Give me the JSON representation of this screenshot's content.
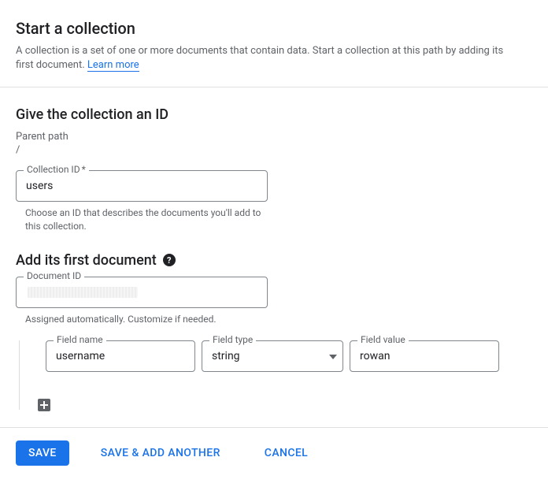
{
  "header": {
    "title": "Start a collection",
    "description": "A collection is a set of one or more documents that contain data. Start a collection at this path by adding its first document.",
    "learn_more": "Learn more"
  },
  "section_id": {
    "title": "Give the collection an ID",
    "parent_path_label": "Parent path",
    "parent_path_value": "/",
    "collection_id_label": "Collection ID",
    "required_mark": "*",
    "collection_id_value": "users",
    "collection_id_helper": "Choose an ID that describes the documents you'll add to this collection."
  },
  "section_doc": {
    "title": "Add its first document",
    "document_id_label": "Document ID",
    "document_id_value": "",
    "document_id_helper": "Assigned automatically. Customize if needed."
  },
  "fields": {
    "field_name_label": "Field name",
    "field_name_value": "username",
    "field_type_label": "Field type",
    "field_type_value": "string",
    "field_value_label": "Field value",
    "field_value_value": "rowan"
  },
  "footer": {
    "save": "SAVE",
    "save_add_another": "SAVE & ADD ANOTHER",
    "cancel": "CANCEL"
  }
}
